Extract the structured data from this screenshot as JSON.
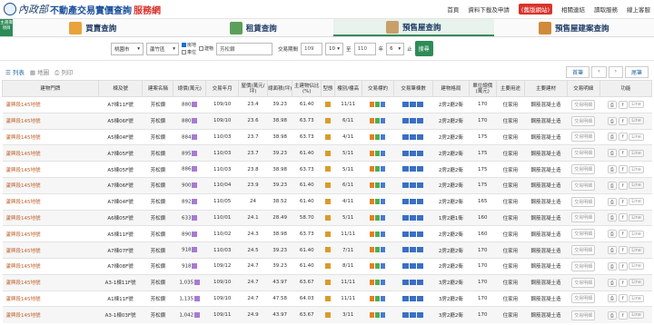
{
  "header": {
    "logo_text1": "內政部",
    "logo_text2": "不動產交易實價查詢",
    "logo_text3": "服務網",
    "nav": [
      "首頁",
      "資料下載及申請",
      "(舊版網站)",
      "相關連結",
      "讀取服務",
      "線上客服"
    ]
  },
  "menu_badge": "主選擇項目",
  "tabs": [
    {
      "label": "買賣查詢",
      "active": false
    },
    {
      "label": "租賃查詢",
      "active": false
    },
    {
      "label": "預售屋查詢",
      "active": true
    },
    {
      "label": "預售屋建案查詢",
      "active": false
    }
  ],
  "filters": {
    "city": "桃園市",
    "district": "蘆竹區",
    "chk_land": "房地",
    "chk_build": "建物",
    "chk_park": "車位",
    "keyword": "芳松鑽",
    "period_label": "交易期間",
    "from_year": "109",
    "from_month": "10",
    "year_unit": "年",
    "to_label": "至",
    "to_year": "110",
    "to_month": "6",
    "end_label": "止",
    "search_label": "搜尋"
  },
  "view": {
    "list": "列表",
    "map": "地圖",
    "print": "列印",
    "first": "首筆",
    "prev": "‹",
    "next": "›",
    "last": "尾筆"
  },
  "columns": [
    "建物門牌",
    "棟及號",
    "建案名稱",
    "總價(萬元)",
    "交易年月",
    "屋價(萬元/坪)",
    "總面積(坪)",
    "主建物佔比(%)",
    "型態",
    "樓別/樓高",
    "交易標的",
    "交易筆棟數",
    "建物格局",
    "單位總價(萬元)",
    "主要用途",
    "主要建材",
    "交易明細",
    "功能"
  ],
  "rows": [
    {
      "addr": "蘆興段145地號",
      "unit": "A7棟11F號",
      "name": "芳松鑽",
      "price": "880",
      "date": "109/10",
      "unit_price": "23.4",
      "area": "39.23",
      "ratio": "61.40",
      "floor": "11/11",
      "layout": "2房2廳2衛",
      "upp": "170",
      "use": "住家用",
      "mat": "鋼筋混凝土造"
    },
    {
      "addr": "蘆興段145地號",
      "unit": "A5棟06F號",
      "name": "芳松鑽",
      "price": "880",
      "date": "109/10",
      "unit_price": "23.6",
      "area": "38.98",
      "ratio": "63.73",
      "floor": "6/11",
      "layout": "2房2廳2衛",
      "upp": "170",
      "use": "住家用",
      "mat": "鋼筋混凝土造"
    },
    {
      "addr": "蘆興段145地號",
      "unit": "A5棟04F號",
      "name": "芳松鑽",
      "price": "884",
      "date": "110/03",
      "unit_price": "23.7",
      "area": "38.98",
      "ratio": "63.73",
      "floor": "4/11",
      "layout": "2房2廳2衛",
      "upp": "175",
      "use": "住家用",
      "mat": "鋼筋混凝土造"
    },
    {
      "addr": "蘆興段145地號",
      "unit": "A7棟05F號",
      "name": "芳松鑽",
      "price": "895",
      "date": "110/03",
      "unit_price": "23.7",
      "area": "39.23",
      "ratio": "61.40",
      "floor": "5/11",
      "layout": "2房2廳2衛",
      "upp": "175",
      "use": "住家用",
      "mat": "鋼筋混凝土造"
    },
    {
      "addr": "蘆興段145地號",
      "unit": "A5棟05F號",
      "name": "芳松鑽",
      "price": "886",
      "date": "110/03",
      "unit_price": "23.8",
      "area": "38.98",
      "ratio": "63.73",
      "floor": "5/11",
      "layout": "2房2廳2衛",
      "upp": "175",
      "use": "住家用",
      "mat": "鋼筋混凝土造"
    },
    {
      "addr": "蘆興段145地號",
      "unit": "A7棟06F號",
      "name": "芳松鑽",
      "price": "900",
      "date": "110/04",
      "unit_price": "23.9",
      "area": "39.23",
      "ratio": "61.40",
      "floor": "6/11",
      "layout": "2房2廳2衛",
      "upp": "175",
      "use": "住家用",
      "mat": "鋼筋混凝土造"
    },
    {
      "addr": "蘆興段145地號",
      "unit": "A7棟04F號",
      "name": "芳松鑽",
      "price": "892",
      "date": "110/05",
      "unit_price": "24",
      "area": "38.52",
      "ratio": "61.40",
      "floor": "4/11",
      "layout": "2房2廳2衛",
      "upp": "165",
      "use": "住家用",
      "mat": "鋼筋混凝土造"
    },
    {
      "addr": "蘆興段145地號",
      "unit": "A6棟05F號",
      "name": "芳松鑽",
      "price": "633",
      "date": "110/01",
      "unit_price": "24.1",
      "area": "28.49",
      "ratio": "58.70",
      "floor": "5/11",
      "layout": "1房2廳1衛",
      "upp": "160",
      "use": "住家用",
      "mat": "鋼筋混凝土造"
    },
    {
      "addr": "蘆興段145地號",
      "unit": "A5棟11F號",
      "name": "芳松鑽",
      "price": "890",
      "date": "110/02",
      "unit_price": "24.3",
      "area": "38.98",
      "ratio": "63.73",
      "floor": "11/11",
      "layout": "2房2廳2衛",
      "upp": "160",
      "use": "住家用",
      "mat": "鋼筋混凝土造"
    },
    {
      "addr": "蘆興段145地號",
      "unit": "A7棟07F號",
      "name": "芳松鑽",
      "price": "918",
      "date": "110/03",
      "unit_price": "24.5",
      "area": "39.23",
      "ratio": "61.40",
      "floor": "7/11",
      "layout": "2房2廳2衛",
      "upp": "170",
      "use": "住家用",
      "mat": "鋼筋混凝土造"
    },
    {
      "addr": "蘆興段145地號",
      "unit": "A7棟08F號",
      "name": "芳松鑽",
      "price": "918",
      "date": "109/12",
      "unit_price": "24.7",
      "area": "39.23",
      "ratio": "61.40",
      "floor": "8/11",
      "layout": "2房2廳2衛",
      "upp": "170",
      "use": "住家用",
      "mat": "鋼筋混凝土造"
    },
    {
      "addr": "蘆興段145地號",
      "unit": "A3-1棟11F號",
      "name": "芳松鑽",
      "price": "1,035",
      "date": "109/10",
      "unit_price": "24.7",
      "area": "43.97",
      "ratio": "63.67",
      "floor": "11/11",
      "layout": "3房2廳2衛",
      "upp": "170",
      "use": "住家用",
      "mat": "鋼筋混凝土造"
    },
    {
      "addr": "蘆興段145地號",
      "unit": "A1棟11F號",
      "name": "芳松鑽",
      "price": "1,135",
      "date": "109/10",
      "unit_price": "24.7",
      "area": "47.58",
      "ratio": "64.03",
      "floor": "11/11",
      "layout": "3房2廳2衛",
      "upp": "170",
      "use": "住家用",
      "mat": "鋼筋混凝土造"
    },
    {
      "addr": "蘆興段145地號",
      "unit": "A3-1棟03F號",
      "name": "芳松鑽",
      "price": "1,042",
      "date": "109/11",
      "unit_price": "24.9",
      "area": "43.97",
      "ratio": "63.67",
      "floor": "3/11",
      "layout": "3房2廳2衛",
      "upp": "170",
      "use": "住家用",
      "mat": "鋼筋混凝土造"
    }
  ],
  "row_labels": {
    "detail": "交易明細",
    "line": "Line",
    "fb": "f"
  }
}
